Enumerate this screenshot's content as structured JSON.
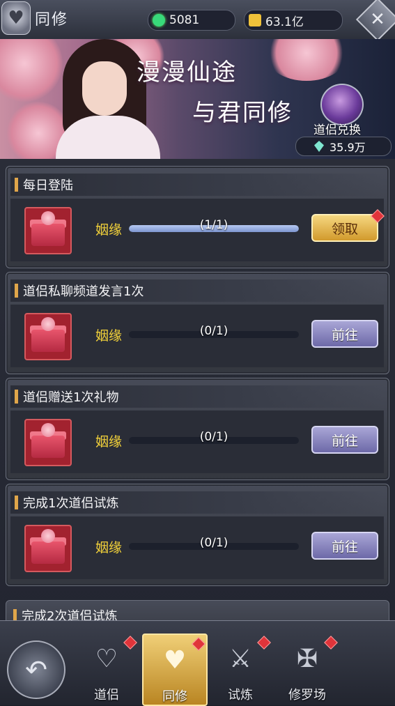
{
  "header": {
    "title": "同修",
    "resource_1": "5081",
    "resource_2": "63.1亿",
    "avatar_icon": "couple-heart-icon",
    "close_icon": "close-icon"
  },
  "banner": {
    "line_1": "漫漫仙途",
    "line_2": "与君同修",
    "exchange_label": "道侣兑换",
    "exchange_count": "35.9万"
  },
  "tasks": [
    {
      "title": "每日登陆",
      "reward": "姻缘",
      "progress": "(1/1)",
      "progress_fraction": 1,
      "button": "领取",
      "button_type": "claim",
      "has_badge": true
    },
    {
      "title": "道侣私聊频道发言1次",
      "reward": "姻缘",
      "progress": "(0/1)",
      "progress_fraction": 0,
      "button": "前往",
      "button_type": "go",
      "has_badge": false
    },
    {
      "title": "道侣赠送1次礼物",
      "reward": "姻缘",
      "progress": "(0/1)",
      "progress_fraction": 0,
      "button": "前往",
      "button_type": "go",
      "has_badge": false
    },
    {
      "title": "完成1次道侣试炼",
      "reward": "姻缘",
      "progress": "(0/1)",
      "progress_fraction": 0,
      "button": "前往",
      "button_type": "go",
      "has_badge": false
    }
  ],
  "partial_task": {
    "title": "完成2次道侣试炼"
  },
  "nav": {
    "back_icon": "back-arrow-icon",
    "tabs": [
      {
        "label": "道侣",
        "icon": "couple-heart-icon",
        "active": false
      },
      {
        "label": "同修",
        "icon": "heart-pair-icon",
        "active": true
      },
      {
        "label": "试炼",
        "icon": "crossed-swords-icon",
        "active": false
      },
      {
        "label": "修罗场",
        "icon": "sword-wings-icon",
        "active": false
      }
    ]
  },
  "colors": {
    "reward_text": "#f3d23a",
    "claim_button": "#d29a2c",
    "go_button": "#6d69a8",
    "progress_fill": "#7d95cf",
    "red_badge": "#e0343a"
  }
}
